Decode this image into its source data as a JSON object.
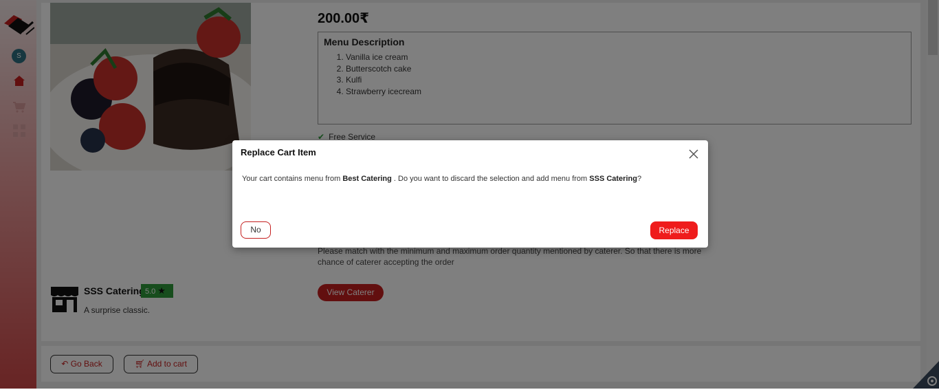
{
  "sidebar": {
    "avatar_initial": "S",
    "icons": [
      "logo-icon",
      "home-icon",
      "cart-icon",
      "grid-icon"
    ]
  },
  "menu": {
    "price": "200.00₹",
    "description_title": "Menu Description",
    "items": [
      "Vanilla ice cream",
      "Butterscotch cake",
      "Kulfi",
      "Strawberry icecream"
    ],
    "free_service": "Free Service",
    "note": "Please match with the minimum and maximum order quantity mentioned by caterer. So that there is more chance of caterer accepting the order",
    "view_caterer_label": "View Caterer"
  },
  "caterer": {
    "name": "SSS Catering",
    "rating": "5.0",
    "tagline": "A surprise classic."
  },
  "footer": {
    "go_back_label": "Go Back",
    "add_to_cart_label": "Add to cart"
  },
  "modal": {
    "title": "Replace Cart Item",
    "body_prefix": "Your cart contains menu from ",
    "current_caterer": "Best Catering",
    "body_middle": " . Do you want to discard the selection and add menu from ",
    "new_caterer": "SSS Catering",
    "body_suffix": "?",
    "no_label": "No",
    "replace_label": "Replace"
  },
  "colors": {
    "accent_red": "#c41e1e",
    "replace_red": "#ef1c1c",
    "rating_green": "#2e9b3a",
    "avatar_teal": "#2f6f80"
  }
}
